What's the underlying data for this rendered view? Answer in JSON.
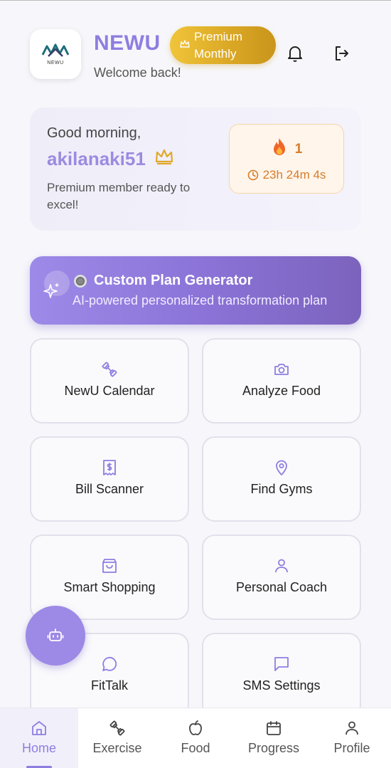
{
  "header": {
    "logo_text": "NEWU",
    "app_name": "NEWU",
    "welcome": "Welcome back!",
    "premium_line1": "Premium",
    "premium_line2": "Monthly"
  },
  "greeting": {
    "hello": "Good morning,",
    "username": "akilanaki51",
    "subtitle": "Premium member ready to excel!",
    "streak_count": "1",
    "streak_timer": "23h 24m 4s"
  },
  "plan_banner": {
    "title": "Custom Plan Generator",
    "subtitle": "AI-powered personalized transformation plan"
  },
  "tiles": [
    {
      "label": "NewU Calendar",
      "icon": "dumbbell-icon"
    },
    {
      "label": "Analyze Food",
      "icon": "camera-icon"
    },
    {
      "label": "Bill Scanner",
      "icon": "receipt-icon"
    },
    {
      "label": "Find Gyms",
      "icon": "map-pin-icon"
    },
    {
      "label": "Smart Shopping",
      "icon": "shopping-bag-icon"
    },
    {
      "label": "Personal Coach",
      "icon": "user-icon"
    },
    {
      "label": "FitTalk",
      "icon": "chat-bubble-icon"
    },
    {
      "label": "SMS Settings",
      "icon": "message-square-icon"
    }
  ],
  "bottom_nav": [
    {
      "label": "Home",
      "icon": "home-icon",
      "active": true
    },
    {
      "label": "Exercise",
      "icon": "dumbbell-icon",
      "active": false
    },
    {
      "label": "Food",
      "icon": "apple-icon",
      "active": false
    },
    {
      "label": "Progress",
      "icon": "calendar-icon",
      "active": false
    },
    {
      "label": "Profile",
      "icon": "user-icon",
      "active": false
    }
  ],
  "colors": {
    "accent": "#8e7ee0",
    "premium_gold": "#e0b02c",
    "streak_orange": "#d77c2a",
    "background": "#f7f7fb"
  }
}
